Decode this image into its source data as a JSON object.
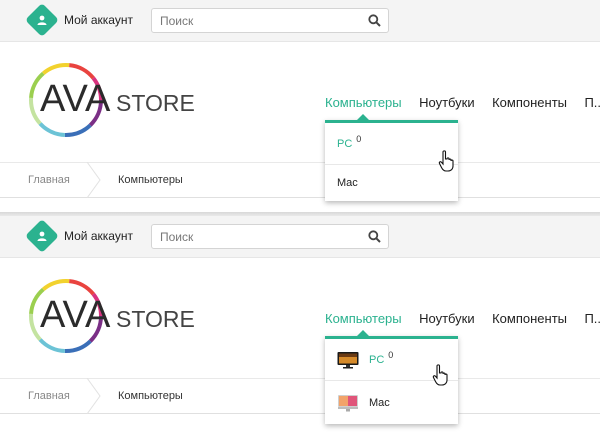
{
  "colors": {
    "accent": "#2bb28f"
  },
  "frames": [
    {
      "account_label": "Мой аккаунт",
      "search_placeholder": "Поиск",
      "logo": {
        "ava": "AVA",
        "store": "STORE"
      },
      "nav": [
        "Компьютеры",
        "Ноутбуки",
        "Компоненты",
        "П..."
      ],
      "dropdown": [
        {
          "label": "PC",
          "count": "0",
          "icon": ""
        },
        {
          "label": "Mac",
          "count": "",
          "icon": ""
        }
      ],
      "breadcrumbs": {
        "home": "Главная",
        "current": "Компьютеры"
      }
    },
    {
      "account_label": "Мой аккаунт",
      "search_placeholder": "Поиск",
      "logo": {
        "ava": "AVA",
        "store": "STORE"
      },
      "nav": [
        "Компьютеры",
        "Ноутбуки",
        "Компоненты",
        "П..."
      ],
      "dropdown": [
        {
          "label": "PC",
          "count": "0",
          "icon": "pc-monitor-thumbnail"
        },
        {
          "label": "Mac",
          "count": "",
          "icon": "imac-thumbnail"
        }
      ],
      "breadcrumbs": {
        "home": "Главная",
        "current": "Компьютеры"
      }
    }
  ]
}
